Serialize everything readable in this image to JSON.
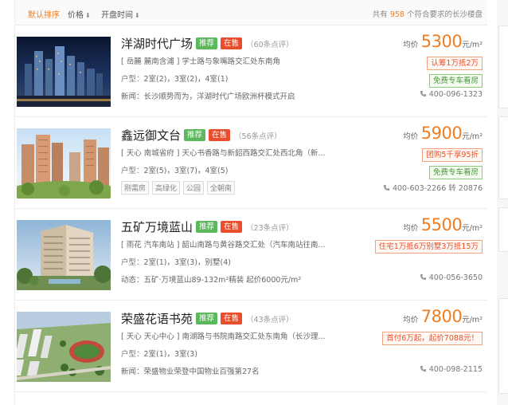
{
  "sortbar": {
    "default_sort": "默认排序",
    "price_sort": "价格",
    "open_time_sort": "开盘时间",
    "count_prefix": "共有",
    "count": "958",
    "count_suffix": "个符合要求的长沙楼盘"
  },
  "listings": [
    {
      "title": "洋湖时代广场",
      "tag_recommend": "推荐",
      "tag_on_sale": "在售",
      "reviews": "（60条点评）",
      "address": "[ 岳麓 麓南含浦 ] 学士路与象嘴路交汇处东南角",
      "layout_label": "户型：",
      "layout": "2室(2)，3室(2)，4室(1)",
      "news_label": "新闻：",
      "news": "长沙顺势而为，洋湖时代广场欧洲杯模式开启",
      "price_label": "均价",
      "price": "5300",
      "price_unit": "元/m²",
      "promo_1": "认筹1万抵2万",
      "promo_2": "免费专车看房",
      "phone": "400-096-1323"
    },
    {
      "title": "鑫远御文台",
      "tag_recommend": "推荐",
      "tag_on_sale": "在售",
      "reviews": "（56条点评）",
      "address": "[ 天心 南城省府 ] 天心书香路与新韶西路交汇处西北角（新...",
      "layout_label": "户型：",
      "layout": "2室(5)，3室(7)，4室(5)",
      "features": [
        "刚需房",
        "高绿化",
        "公园",
        "全朝南"
      ],
      "price_label": "均价",
      "price": "5900",
      "price_unit": "元/m²",
      "promo_1": "团购5千享95折",
      "promo_2": "免费专车看房",
      "phone": "400-603-2266 转 20876"
    },
    {
      "title": "五矿万境蓝山",
      "tag_recommend": "推荐",
      "tag_on_sale": "在售",
      "reviews": "（23条点评）",
      "address": "[ 雨花 汽车南站 ] 韶山南路与黄谷路交汇处（汽车南站往南...",
      "layout_label": "户型：",
      "layout": "2室(1)，3室(3)，别墅(4)",
      "news_label": "动态：",
      "news": "五矿·万境蓝山89-132m²精装 起价6000元/m²",
      "price_label": "均价",
      "price": "5500",
      "price_unit": "元/m²",
      "promo_1": "住宅1万抵6万别墅3万抵15万",
      "phone": "400-056-3650"
    },
    {
      "title": "荣盛花语书苑",
      "tag_recommend": "推荐",
      "tag_on_sale": "在售",
      "reviews": "（43条点评）",
      "address": "[ 天心 天心中心 ] 南湖路与书院南路交汇处东南角（长沙理...",
      "layout_label": "户型：",
      "layout": "2室(1)，3室(3)",
      "news_label": "新闻：",
      "news": "荣盛物业荣登中国物业百强第27名",
      "price_label": "均价",
      "price": "7800",
      "price_unit": "元/m²",
      "promo_1": "首付6万起，起价7088元！",
      "phone": "400-098-2115"
    }
  ]
}
